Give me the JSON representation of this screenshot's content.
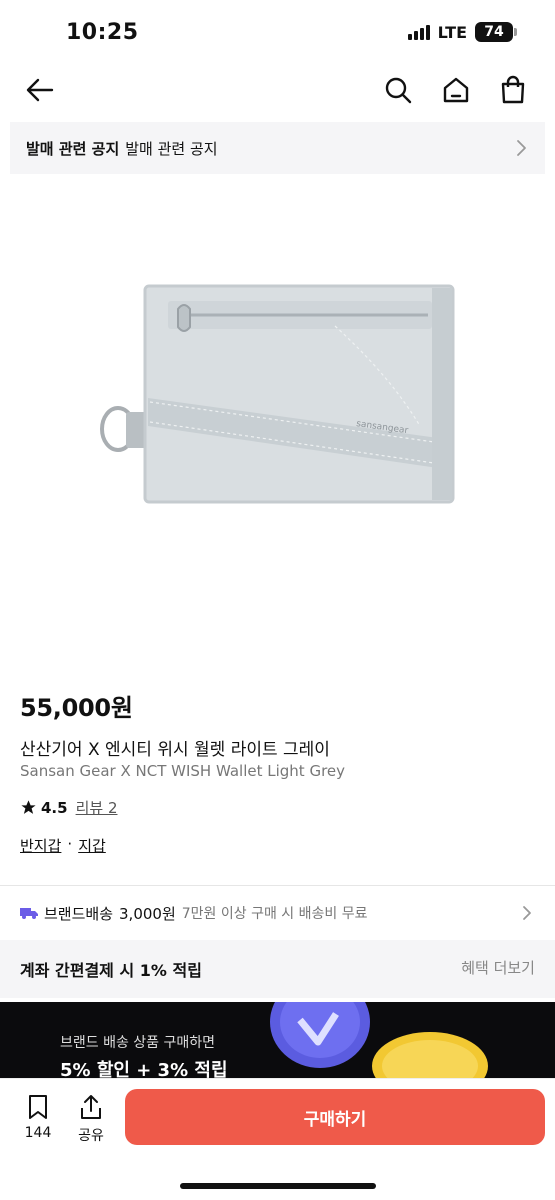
{
  "status_bar": {
    "time": "10:25",
    "network": "LTE",
    "battery": "74"
  },
  "nav": {
    "back": "arrow-left-icon",
    "search": "search-icon",
    "home": "home-icon",
    "cart": "shopping-bag-icon"
  },
  "notice": {
    "label": "발매 관련 공지",
    "text": "발매 관련 공지"
  },
  "product": {
    "price": "55,000원",
    "name_ko": "산산기어 X 엔시티 위시 월렛 라이트 그레이",
    "name_en": "Sansan Gear X NCT WISH Wallet Light Grey",
    "rating": "4.5",
    "review_label": "리뷰 2",
    "category": [
      "반지갑",
      "지갑"
    ],
    "category_sep": "·"
  },
  "shipping": {
    "label": "브랜드배송",
    "fee": "3,000원",
    "condition": "7만원 이상 구매 시 배송비 무료"
  },
  "benefit": {
    "label": "계좌 간편결제 시 1% 적립",
    "more": "혜택 더보기"
  },
  "banner": {
    "line1": "브랜드 배송 상품 구매하면",
    "line2": "5% 할인 + 3% 적립"
  },
  "bottom_bar": {
    "like_count": "144",
    "share_label": "공유",
    "buy_label": "구매하기"
  },
  "colors": {
    "accent": "#ef5a4a",
    "shipping_icon": "#6b5ce7",
    "banner_bg": "#0b0b0d"
  }
}
